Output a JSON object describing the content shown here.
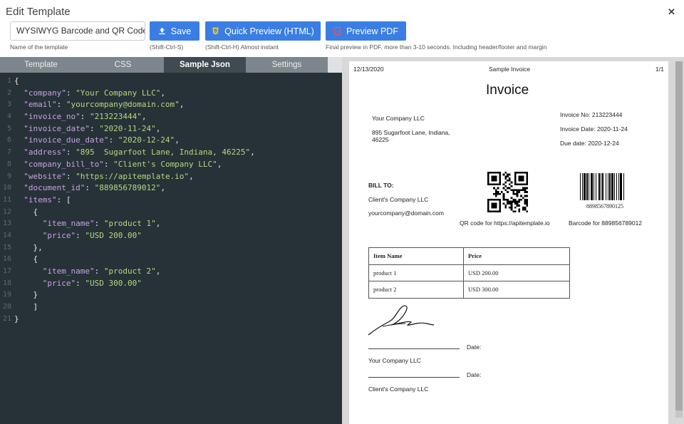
{
  "header": {
    "title": "Edit Template",
    "close_icon": "close-icon"
  },
  "toolbar": {
    "template_name_value": "WYSIWYG Barcode and QR Code Sa",
    "template_name_hint": "Name of the template",
    "save_label": "Save",
    "save_hint": "(Shift-Ctrl-S)",
    "quick_preview_label": "Quick Preview (HTML)",
    "quick_preview_hint": "(Shift-Ctrl-H) Almost instant",
    "preview_pdf_label": "Preview PDF",
    "preview_pdf_hint": "Final preview in PDF, more than 3-10 seconds. Including header/footer and margin",
    "colors": {
      "button": "#3a7ee4"
    }
  },
  "tabs": [
    {
      "label": "Template"
    },
    {
      "label": "CSS"
    },
    {
      "label": "Sample Json",
      "active": true
    },
    {
      "label": "Settings"
    }
  ],
  "code_lines": [
    {
      "n": "1",
      "tokens": [
        [
          "p",
          "{"
        ]
      ]
    },
    {
      "n": "2",
      "tokens": [
        [
          "k",
          "  \"company\""
        ],
        [
          "p",
          ": "
        ],
        [
          "s",
          "\"Your Company LLC\""
        ],
        [
          "p",
          ","
        ]
      ]
    },
    {
      "n": "3",
      "tokens": [
        [
          "k",
          "  \"email\""
        ],
        [
          "p",
          ": "
        ],
        [
          "s",
          "\"yourcompany@domain.com\""
        ],
        [
          "p",
          ","
        ]
      ]
    },
    {
      "n": "4",
      "tokens": [
        [
          "k",
          "  \"invoice_no\""
        ],
        [
          "p",
          ": "
        ],
        [
          "s",
          "\"213223444\""
        ],
        [
          "p",
          ","
        ]
      ]
    },
    {
      "n": "5",
      "tokens": [
        [
          "k",
          "  \"invoice_date\""
        ],
        [
          "p",
          ": "
        ],
        [
          "s",
          "\"2020-11-24\""
        ],
        [
          "p",
          ","
        ]
      ]
    },
    {
      "n": "6",
      "tokens": [
        [
          "k",
          "  \"invoice_due_date\""
        ],
        [
          "p",
          ": "
        ],
        [
          "s",
          "\"2020-12-24\""
        ],
        [
          "p",
          ","
        ]
      ]
    },
    {
      "n": "7",
      "tokens": [
        [
          "k",
          "  \"address\""
        ],
        [
          "p",
          ": "
        ],
        [
          "s",
          "\"895  Sugarfoot Lane, Indiana, 46225\""
        ],
        [
          "p",
          ","
        ]
      ]
    },
    {
      "n": "8",
      "tokens": [
        [
          "k",
          "  \"company_bill_to\""
        ],
        [
          "p",
          ": "
        ],
        [
          "s",
          "\"Client's Company LLC\""
        ],
        [
          "p",
          ","
        ]
      ]
    },
    {
      "n": "9",
      "tokens": [
        [
          "k",
          "  \"website\""
        ],
        [
          "p",
          ": "
        ],
        [
          "s",
          "\"https://apitemplate.io\""
        ],
        [
          "p",
          ","
        ]
      ]
    },
    {
      "n": "10",
      "tokens": [
        [
          "k",
          "  \"document_id\""
        ],
        [
          "p",
          ": "
        ],
        [
          "s",
          "\"889856789012\""
        ],
        [
          "p",
          ","
        ]
      ]
    },
    {
      "n": "11",
      "tokens": [
        [
          "k",
          "  \"items\""
        ],
        [
          "p",
          ": ["
        ]
      ]
    },
    {
      "n": "12",
      "tokens": [
        [
          "p",
          "    {"
        ]
      ]
    },
    {
      "n": "13",
      "tokens": [
        [
          "k",
          "      \"item_name\""
        ],
        [
          "p",
          ": "
        ],
        [
          "s",
          "\"product 1\""
        ],
        [
          "p",
          ","
        ]
      ]
    },
    {
      "n": "14",
      "tokens": [
        [
          "k",
          "      \"price\""
        ],
        [
          "p",
          ": "
        ],
        [
          "s",
          "\"USD 200.00\""
        ]
      ]
    },
    {
      "n": "15",
      "tokens": [
        [
          "p",
          "    },"
        ]
      ]
    },
    {
      "n": "16",
      "tokens": [
        [
          "p",
          "    {"
        ]
      ]
    },
    {
      "n": "17",
      "tokens": [
        [
          "k",
          "      \"item_name\""
        ],
        [
          "p",
          ": "
        ],
        [
          "s",
          "\"product 2\""
        ],
        [
          "p",
          ","
        ]
      ]
    },
    {
      "n": "18",
      "tokens": [
        [
          "k",
          "      \"price\""
        ],
        [
          "p",
          ": "
        ],
        [
          "s",
          "\"USD 300.00\""
        ]
      ]
    },
    {
      "n": "19",
      "tokens": [
        [
          "p",
          "    }"
        ]
      ]
    },
    {
      "n": "20",
      "tokens": [
        [
          "p",
          "    ]"
        ]
      ]
    },
    {
      "n": "21",
      "tokens": [
        [
          "p",
          "}"
        ]
      ]
    }
  ],
  "preview": {
    "page_date": "12/13/2020",
    "page_title": "Sample Invoice",
    "page_number": "1/1",
    "invoice_title": "Invoice",
    "company": "Your Company LLC",
    "address_line1": "895 Sugarfoot Lane, Indiana,",
    "address_line2": "46225",
    "invoice_no": "Invoice No: 213223444",
    "invoice_date": "Invoice Date: 2020-11-24",
    "due_date": "Due date: 2020-12-24",
    "bill_to_label": "BILL TO:",
    "bill_to_company": "Client's Company LLC",
    "bill_to_email": "yourcompany@domain.com",
    "barcode_number": "8898567890125",
    "qr_caption": "QR code for https://apitemplate.io",
    "barcode_caption": "Barcode for 889856789012",
    "table_headers": [
      "Item Name",
      "Price"
    ],
    "table_rows": [
      [
        "product 1",
        "USD 200.00"
      ],
      [
        "product 2",
        "USD 300.00"
      ]
    ],
    "date_label_1": "Date:",
    "sign_company_1": "Your Company LLC",
    "date_label_2": "Date:",
    "sign_company_2": "Client's Company LLC"
  }
}
